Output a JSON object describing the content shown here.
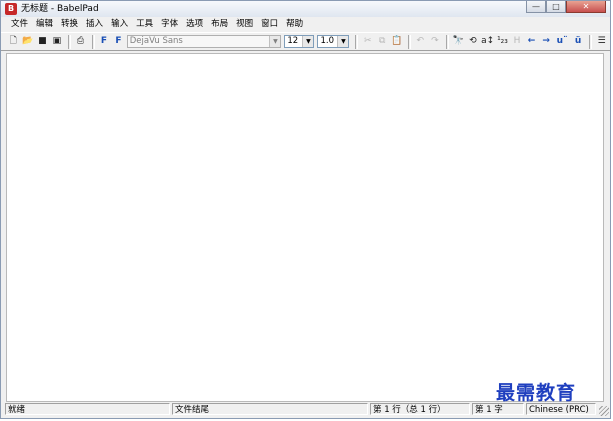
{
  "window": {
    "title": "无标题 - BabelPad",
    "app_icon_text": "B",
    "controls": {
      "minimize": "—",
      "maximize": "□",
      "close": "✕"
    }
  },
  "menu": [
    "文件",
    "编辑",
    "转换",
    "插入",
    "输入",
    "工具",
    "字体",
    "选项",
    "布局",
    "视图",
    "窗口",
    "帮助"
  ],
  "toolbar": {
    "font_name": "DejaVu Sans",
    "font_size": "12",
    "line_spacing": "1.0",
    "icons": {
      "new": "🗋",
      "open": "📂",
      "save": "■",
      "save_all": "▣",
      "print": "⎙",
      "font_bold_f": "F",
      "font_f": "F",
      "cut": "✂",
      "copy": "⧉",
      "paste": "📋",
      "undo": "↶",
      "redo": "↷",
      "find": "🔭",
      "find_replace": "⟲",
      "sort_az": "a↕",
      "number": "¹₂₃",
      "h": "H",
      "left": "←",
      "right": "→",
      "u_umlaut_sup": "u¨",
      "u_umlaut": "ü",
      "align": "☰"
    }
  },
  "status": {
    "ready": "就绪",
    "position": "文件结尾",
    "line": "第 1 行（总 1 行）",
    "char": "第 1 字",
    "lang": "Chinese (PRC)"
  },
  "watermark": "最需教育"
}
